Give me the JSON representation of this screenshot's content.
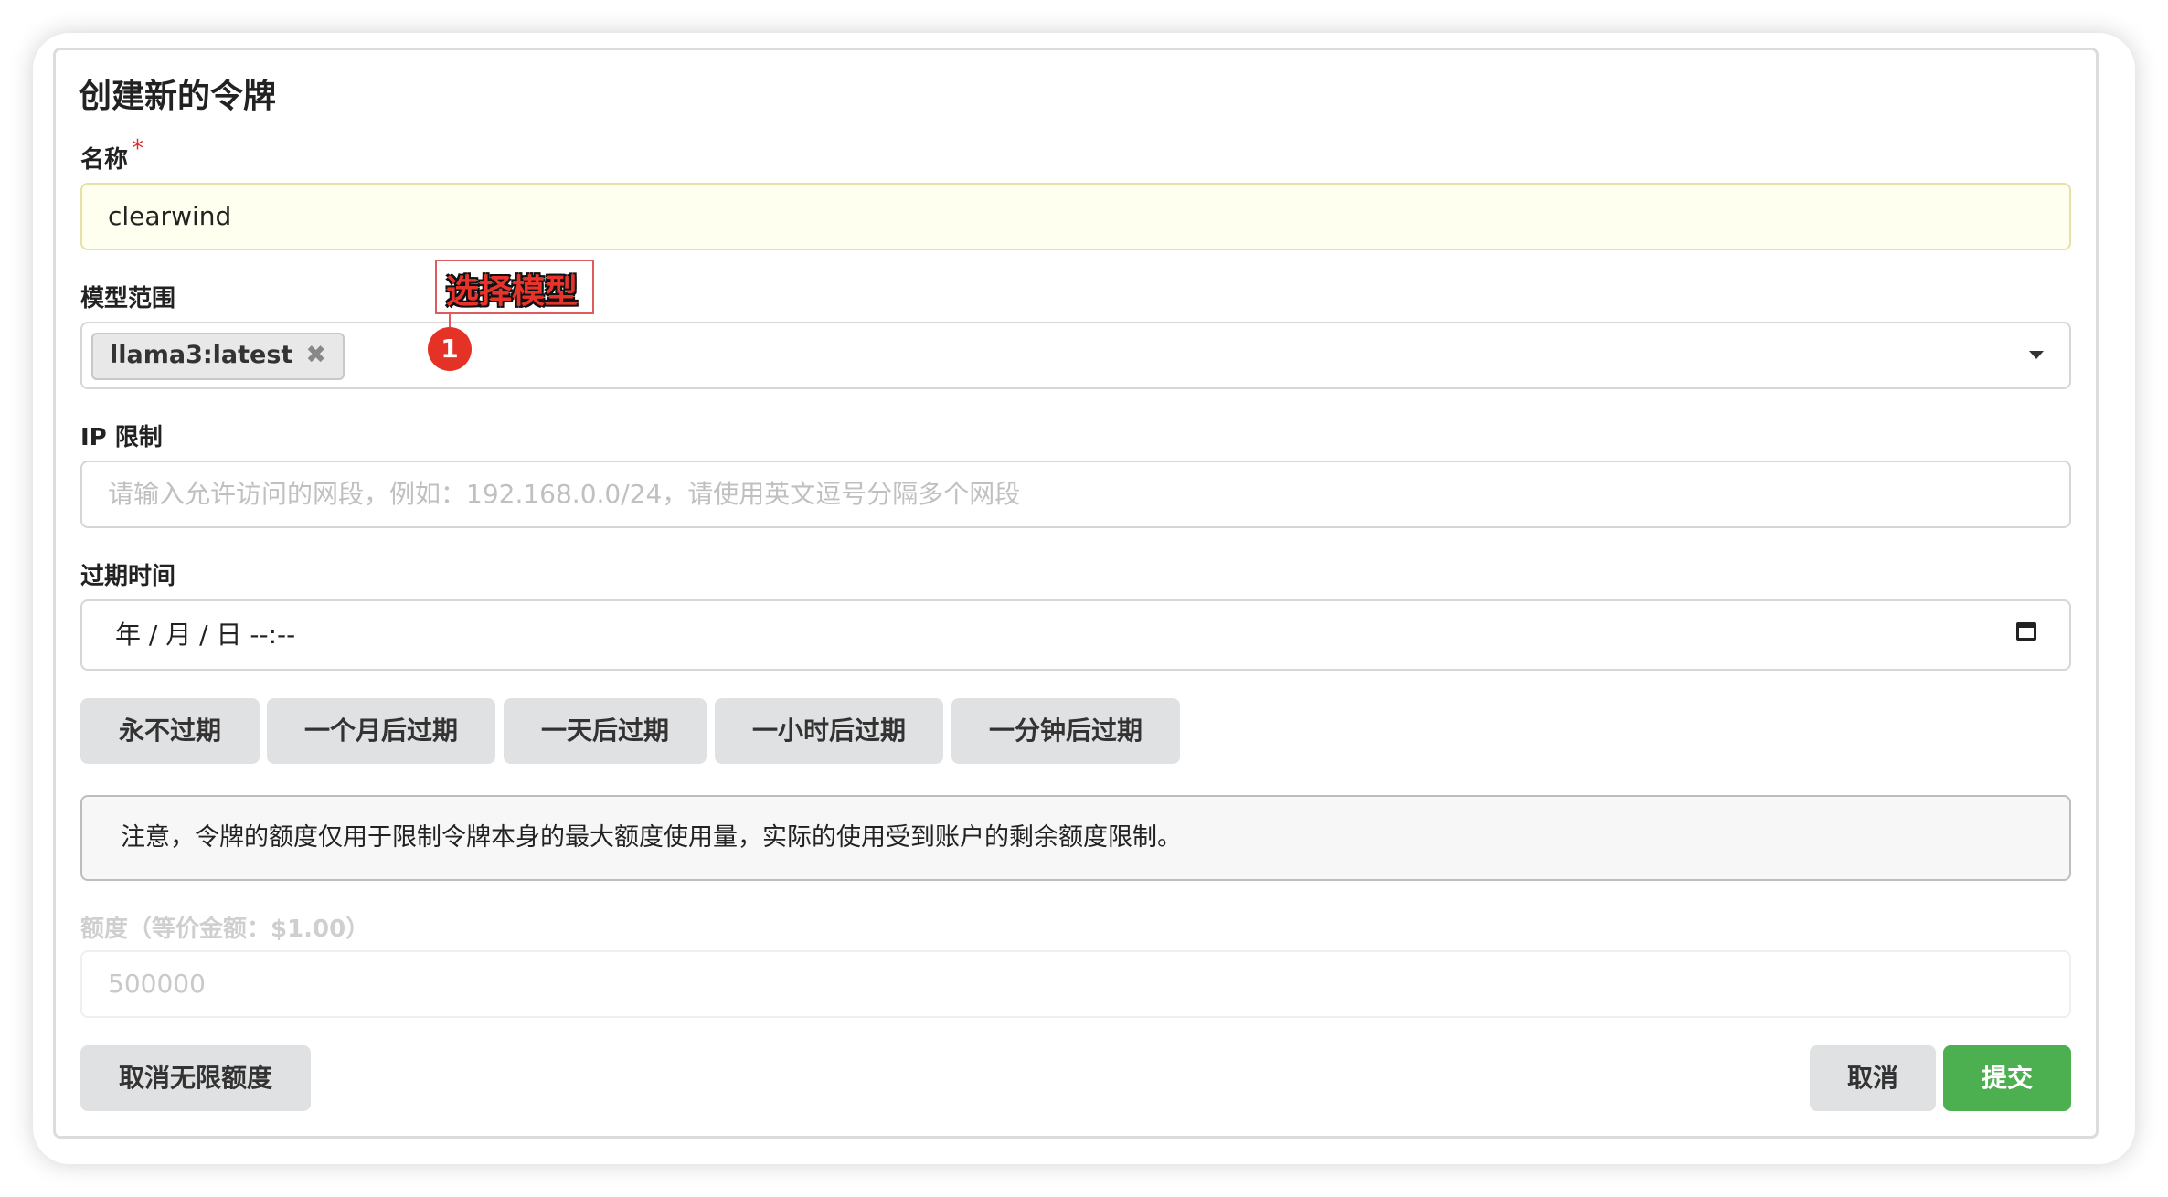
{
  "dialog": {
    "title": "创建新的令牌"
  },
  "name_field": {
    "label": "名称",
    "required_mark": "*",
    "value": "clearwind"
  },
  "model_scope": {
    "label": "模型范围",
    "selected_chip": "llama3:latest",
    "chip_remove_glyph": "✖"
  },
  "annotation": {
    "text": "选择模型",
    "step_number": "1"
  },
  "ip_limit": {
    "label": "IP 限制",
    "placeholder": "请输入允许访问的网段，例如：192.168.0.0/24，请使用英文逗号分隔多个网段"
  },
  "expire": {
    "label": "过期时间",
    "datetime_value": "年 / 月 / 日  --:--",
    "buttons": [
      "永不过期",
      "一个月后过期",
      "一天后过期",
      "一小时后过期",
      "一分钟后过期"
    ]
  },
  "notice": {
    "text": "注意，令牌的额度仅用于限制令牌本身的最大额度使用量，实际的使用受到账户的剩余额度限制。"
  },
  "quota": {
    "label": "额度（等价金额：$1.00）",
    "value": "500000"
  },
  "footer": {
    "unlimited_button": "取消无限额度",
    "cancel_button": "取消",
    "submit_button": "提交"
  },
  "colors": {
    "submit_green": "#4caf50",
    "annotation_red": "#e53226",
    "name_field_bg": "#fffff0"
  }
}
